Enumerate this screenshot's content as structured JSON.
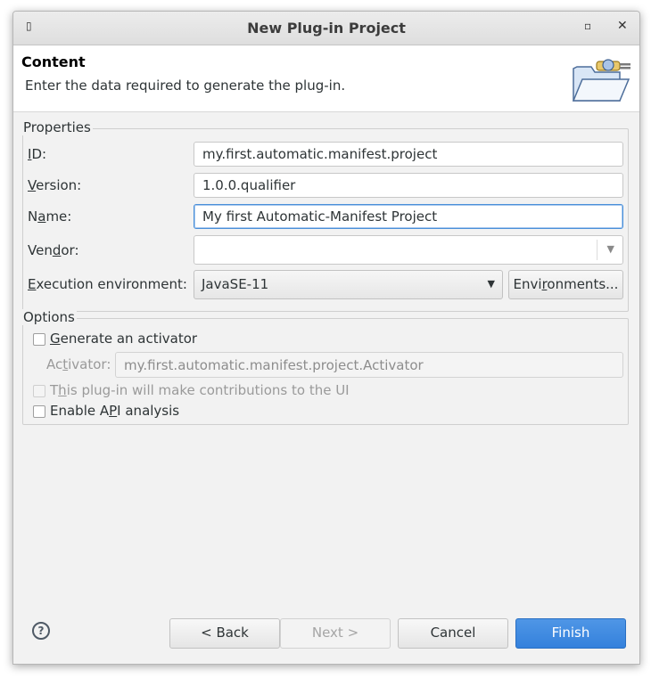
{
  "window": {
    "title": "New Plug-in Project"
  },
  "header": {
    "title": "Content",
    "description": "Enter the data required to generate the plug-in."
  },
  "properties": {
    "group_label": "Properties",
    "id_label_mn": "I",
    "id_label_rest": "D:",
    "id_value": "my.first.automatic.manifest.project",
    "version_label_mn": "V",
    "version_label_rest": "ersion:",
    "version_value": "1.0.0.qualifier",
    "name_label_pre": "N",
    "name_label_mn": "a",
    "name_label_rest": "me:",
    "name_value": "My first Automatic-Manifest Project",
    "vendor_label_pre": "Ven",
    "vendor_label_mn": "d",
    "vendor_label_rest": "or:",
    "vendor_value": "",
    "exec_label_mn": "E",
    "exec_label_rest": "xecution environment:",
    "exec_value": "JavaSE-11",
    "environments_pre": "Envi",
    "environments_mn": "r",
    "environments_rest": "onments..."
  },
  "options": {
    "group_label": "Options",
    "gen_activator_mn": "G",
    "gen_activator_rest": "enerate an activator",
    "gen_activator_checked": false,
    "activator_label_pre": "Ac",
    "activator_label_mn": "t",
    "activator_label_rest": "ivator:",
    "activator_value": "my.first.automatic.manifest.project.Activator",
    "ui_contrib_pre": "T",
    "ui_contrib_mn": "h",
    "ui_contrib_rest": "is plug-in will make contributions to the UI",
    "ui_contrib_checked": false,
    "api_pre": "Enable A",
    "api_mn": "P",
    "api_rest": "I analysis",
    "api_checked": false
  },
  "footer": {
    "help_glyph": "?",
    "back_label": "< Back",
    "next_label": "Next >",
    "cancel_label": "Cancel",
    "finish_label": "Finish"
  },
  "colors": {
    "primary": "#3a86dd",
    "focus_border": "#4a90d9"
  }
}
